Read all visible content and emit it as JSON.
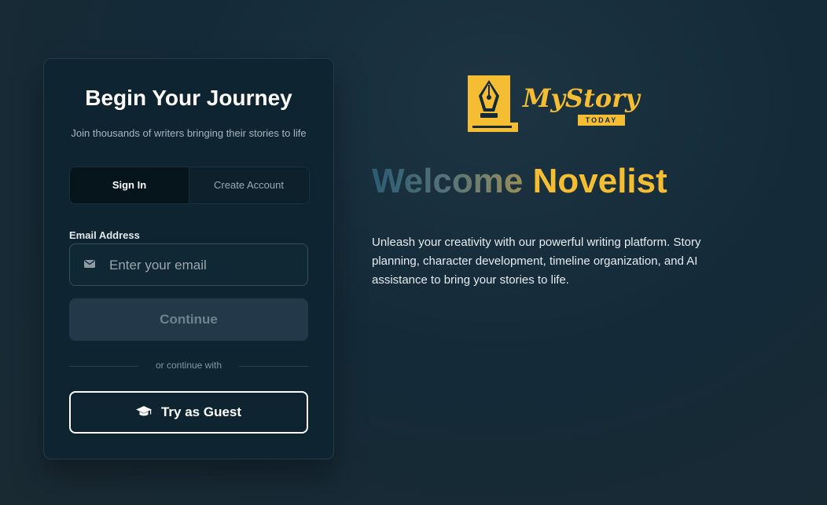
{
  "card": {
    "title": "Begin Your Journey",
    "subtitle": "Join thousands of writers bringing their stories to life",
    "tabs": [
      {
        "label": "Sign In",
        "active": true
      },
      {
        "label": "Create Account",
        "active": false
      }
    ],
    "email_label": "Email Address",
    "email_placeholder": "Enter your email",
    "email_value": "",
    "continue_label": "Continue",
    "divider_text": "or continue with",
    "guest_label": "Try as Guest",
    "icons": {
      "email": "envelope-icon",
      "guest": "graduation-cap-icon"
    }
  },
  "brand": {
    "logo_word": "MyStory",
    "logo_sub": "TODAY",
    "welcome_word1": "Welcome",
    "welcome_word2": "Novelist",
    "description": "Unleash your creativity with our powerful writing platform. Story planning, character development, timeline organization, and AI assistance to bring your stories to life."
  },
  "colors": {
    "accent": "#f5bd32",
    "background": "#142a38",
    "card": "#0f2431"
  }
}
